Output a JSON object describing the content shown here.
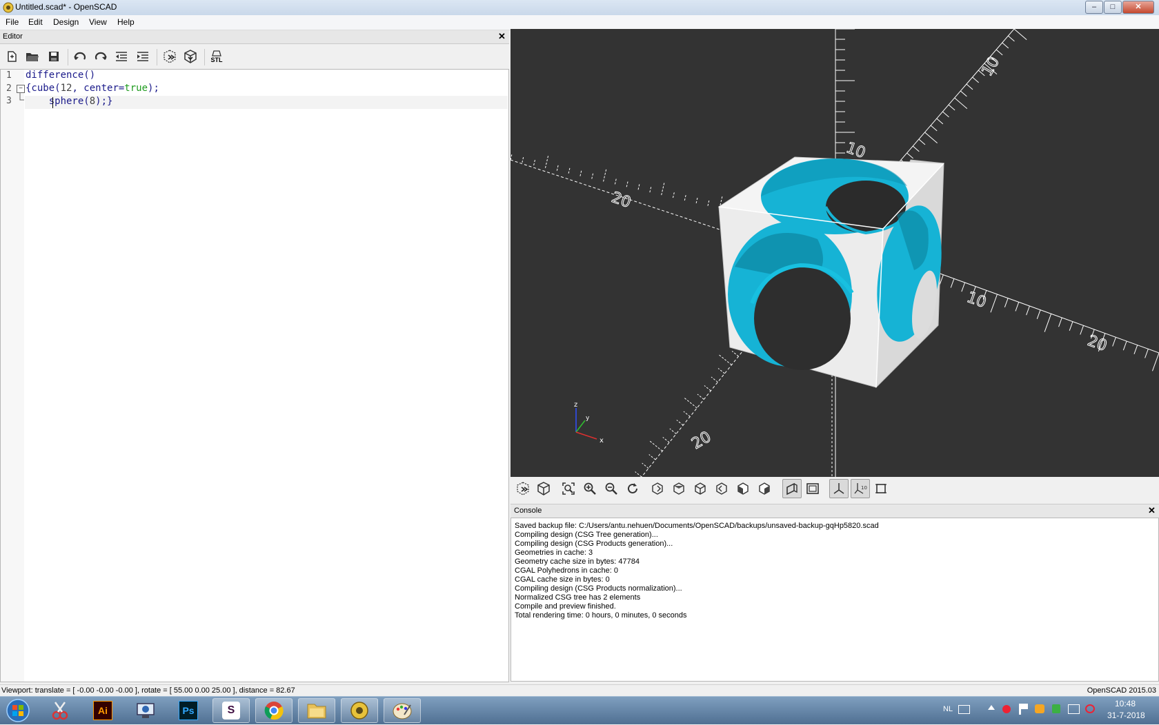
{
  "window": {
    "title": "Untitled.scad* - OpenSCAD",
    "min": "–",
    "max": "□",
    "close": "✕"
  },
  "menubar": {
    "items": [
      "File",
      "Edit",
      "Design",
      "View",
      "Help"
    ]
  },
  "editor": {
    "title": "Editor",
    "close": "✕",
    "toolbar": [
      "new-file",
      "open-file",
      "save-file",
      "undo",
      "redo",
      "unindent",
      "indent",
      "preview",
      "render",
      "export-stl"
    ],
    "stl_label": "STL",
    "lines": [
      {
        "num": "1",
        "text": "difference()"
      },
      {
        "num": "2",
        "text": "{cube(12, center=true);"
      },
      {
        "num": "3",
        "text": "    sphere(8);}"
      }
    ],
    "line2_parts": {
      "a": "{cube(",
      "b": "12",
      "c": ", center=",
      "d": "true",
      "e": ");"
    },
    "line3_parts": {
      "a": "    sphere(",
      "b": "8",
      "c": ");}"
    }
  },
  "viewport": {
    "axis_labels": {
      "x": "x",
      "y": "y",
      "z": "z"
    },
    "scale_labels": [
      "20",
      "20",
      "10",
      "10",
      "10",
      "20"
    ],
    "colors": {
      "background": "#333333",
      "object": "#f2f2f2",
      "cut_surface": "#16b3d5"
    }
  },
  "view_toolbar": [
    "preview",
    "render",
    "view-all",
    "zoom-in",
    "zoom-out",
    "reset-view",
    "view-right",
    "view-top",
    "view-bottom",
    "view-left",
    "view-front",
    "view-back",
    "perspective",
    "orthogonal",
    "show-axes",
    "show-scale-markers",
    "show-edges"
  ],
  "console": {
    "title": "Console",
    "close": "✕",
    "lines": [
      "Saved backup file: C:/Users/antu.nehuen/Documents/OpenSCAD/backups/unsaved-backup-gqHp5820.scad",
      "Compiling design (CSG Tree generation)...",
      "Compiling design (CSG Products generation)...",
      "Geometries in cache: 3",
      "Geometry cache size in bytes: 47784",
      "CGAL Polyhedrons in cache: 0",
      "CGAL cache size in bytes: 0",
      "Compiling design (CSG Products normalization)...",
      "Normalized CSG tree has 2 elements",
      "Compile and preview finished.",
      "Total rendering time: 0 hours, 0 minutes, 0 seconds"
    ]
  },
  "statusbar": {
    "viewport": "Viewport: translate = [ -0.00 -0.00 -0.00 ], rotate = [ 55.00 0.00 25.00 ], distance = 82.67",
    "version": "OpenSCAD 2015.03"
  },
  "taskbar": {
    "apps": [
      "start",
      "snipping-tool",
      "illustrator",
      "remote-desktop",
      "photoshop",
      "slack",
      "chrome",
      "file-explorer",
      "openscad",
      "paint"
    ],
    "illustrator_label": "Ai",
    "photoshop_label": "Ps",
    "slack_label": "S",
    "lang": "NL",
    "time": "10:48",
    "date": "31-7-2018"
  }
}
